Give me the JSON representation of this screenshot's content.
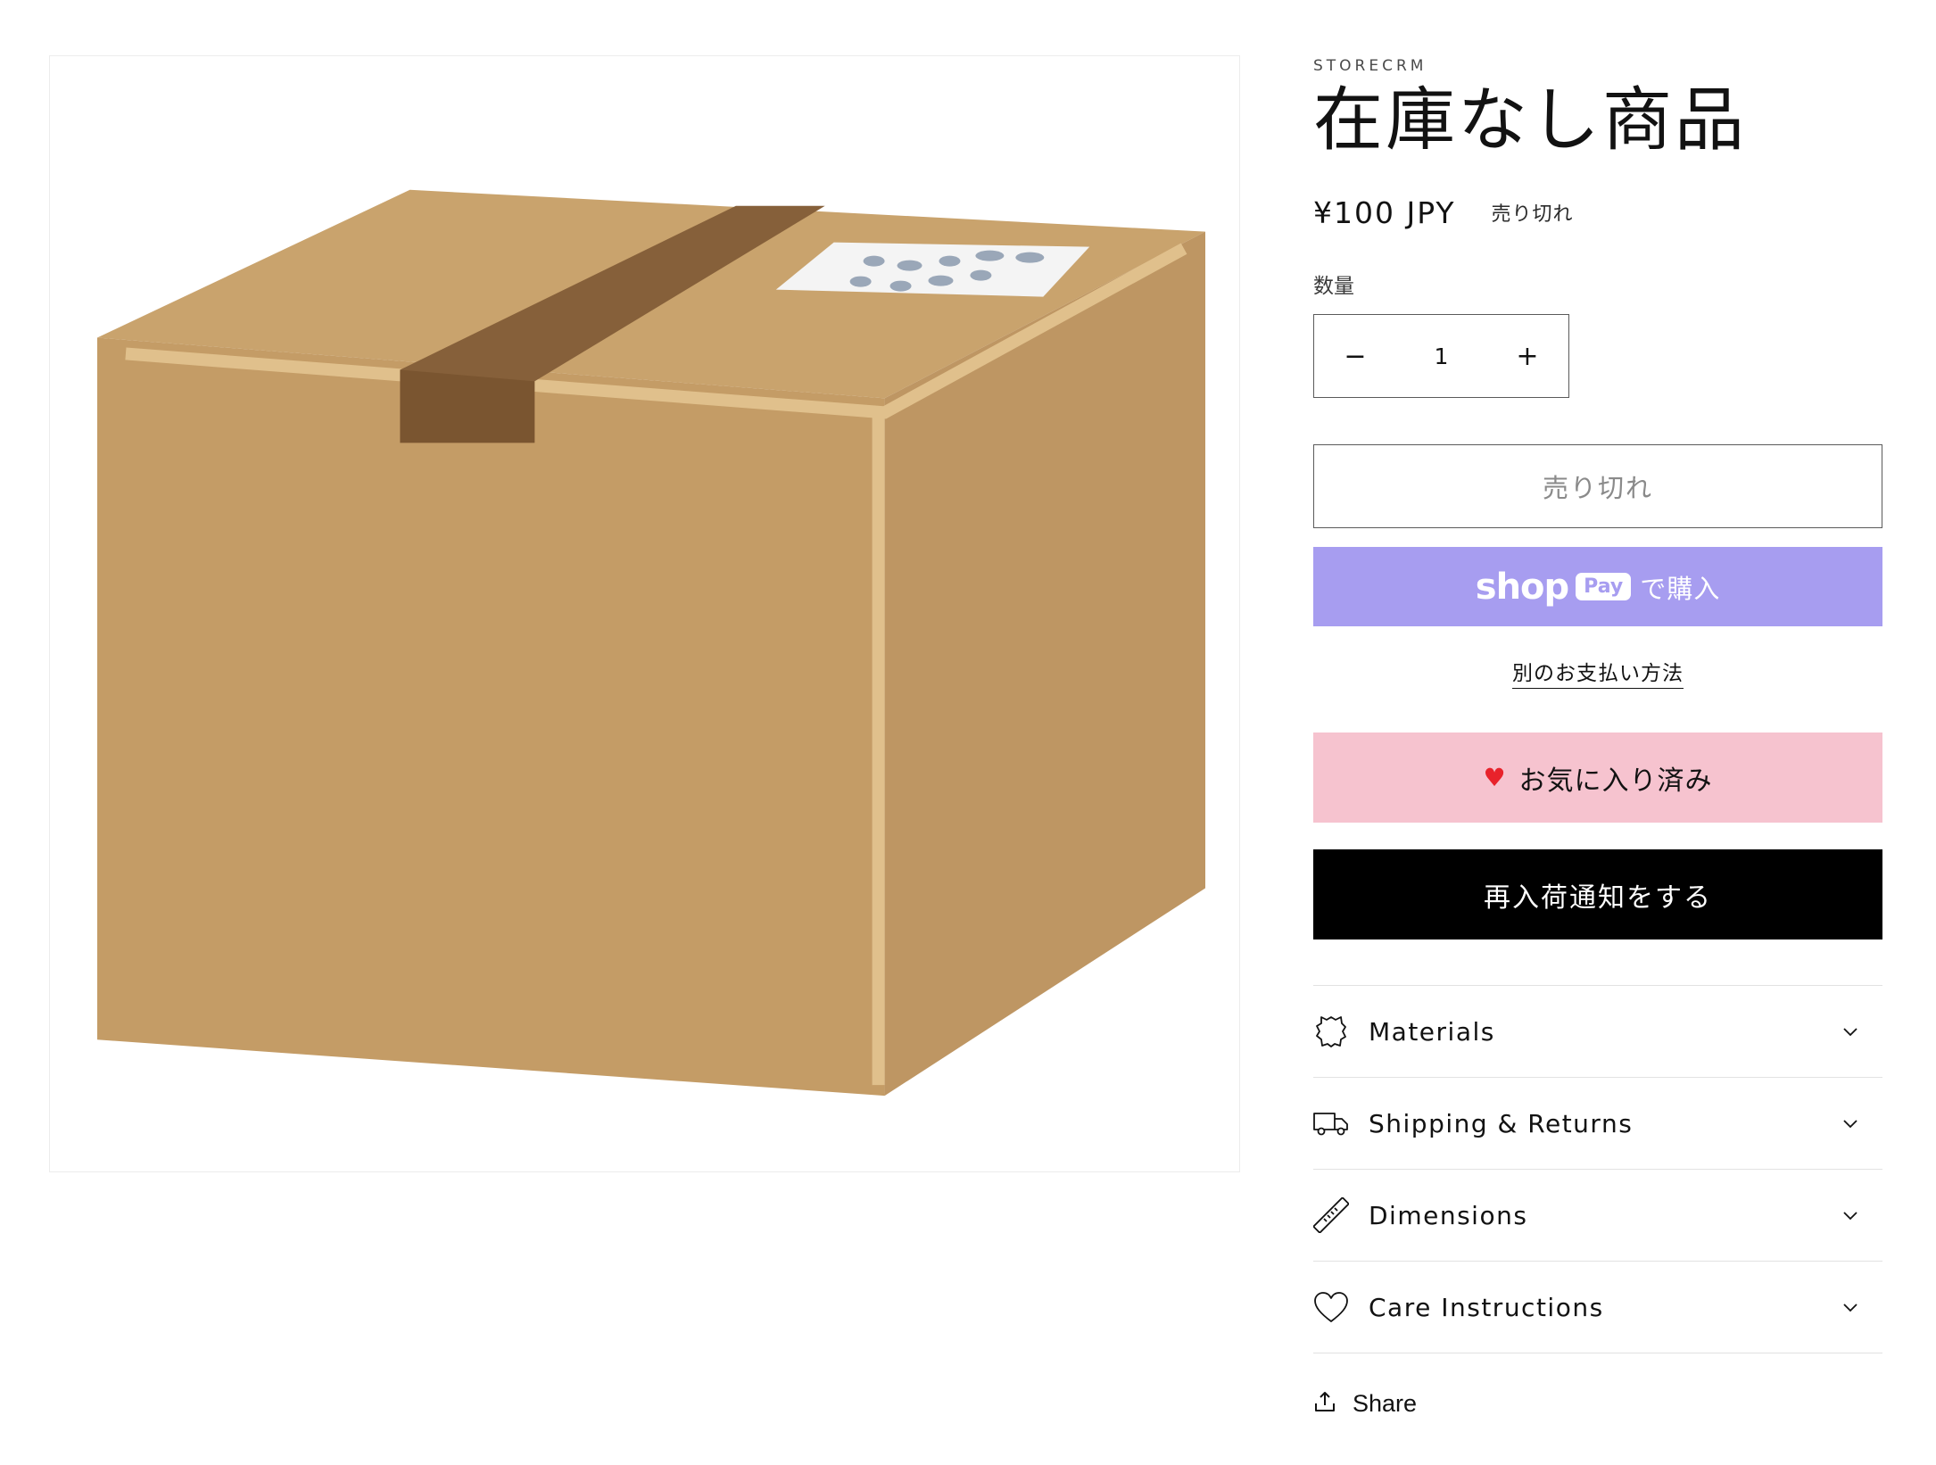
{
  "product": {
    "vendor": "STORECRM",
    "title": "在庫なし商品",
    "price": "¥100 JPY",
    "sold_out_badge": "売り切れ",
    "quantity_label": "数量",
    "quantity_value": "1",
    "decrease_symbol": "−",
    "increase_symbol": "+"
  },
  "buttons": {
    "sold_out": "売り切れ",
    "shop_pay_shop": "shop",
    "shop_pay_pay": "Pay",
    "shop_pay_buy": "で購入",
    "alt_payment": "別のお支払い方法",
    "favorite": "お気に入り済み",
    "notify": "再入荷通知をする"
  },
  "accordion": [
    {
      "label": "Materials",
      "icon": "leather-icon"
    },
    {
      "label": "Shipping & Returns",
      "icon": "truck-icon"
    },
    {
      "label": "Dimensions",
      "icon": "ruler-icon"
    },
    {
      "label": "Care Instructions",
      "icon": "heart-outline-icon"
    }
  ],
  "share": {
    "label": "Share",
    "icon": "share-icon"
  },
  "colors": {
    "shop_pay": "#a79df0",
    "favorite_bg": "#f6c3cf",
    "notify_bg": "#000000",
    "heart": "#e8222b"
  }
}
